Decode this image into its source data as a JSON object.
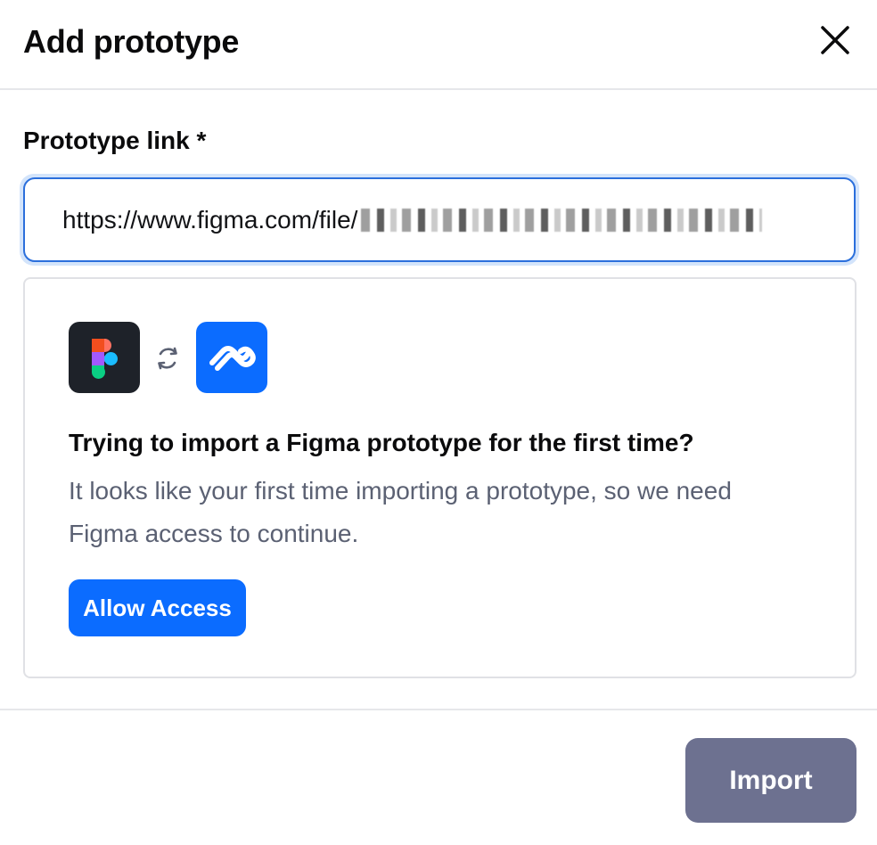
{
  "dialog": {
    "title": "Add prototype",
    "close_icon": "close-icon"
  },
  "prototype_link": {
    "label": "Prototype link *",
    "value_prefix": "https://www.figma.com/file/",
    "value_redacted": true
  },
  "notice": {
    "icons": [
      "figma-logo-icon",
      "sync-icon",
      "maze-logo-icon"
    ],
    "title": "Trying to import a Figma prototype for the first time?",
    "body": "It looks like your first time importing a prototype, so we need Figma access to continue.",
    "button_label": "Allow Access"
  },
  "footer": {
    "import_label": "Import",
    "import_enabled": false
  },
  "colors": {
    "accent": "#0b6cff",
    "input_border": "#2b6fdc",
    "disabled_button": "#6d7190",
    "muted_text": "#5b6173"
  }
}
